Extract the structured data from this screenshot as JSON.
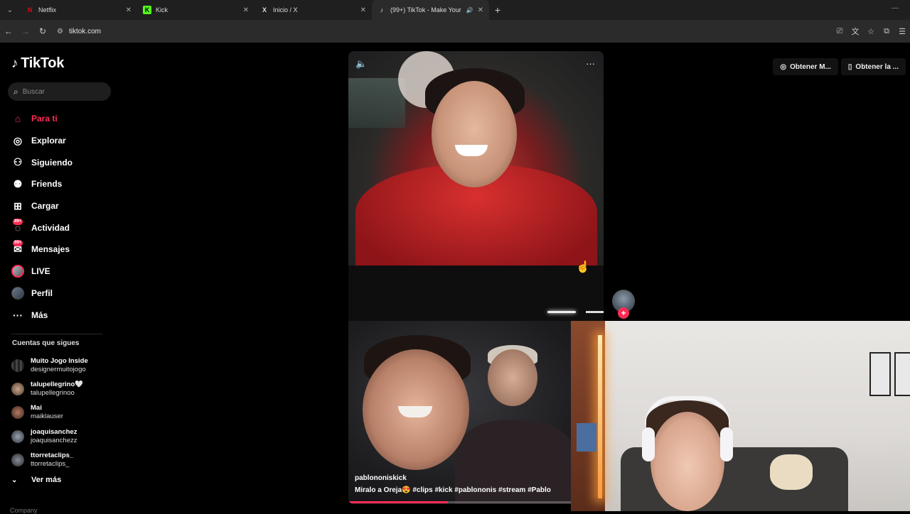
{
  "browser": {
    "tabs": [
      {
        "title": "Netflix",
        "favicon": "N",
        "favicon_color": "#e50914",
        "active": false
      },
      {
        "title": "Kick",
        "favicon": "K",
        "favicon_color": "#53fc18",
        "active": false
      },
      {
        "title": "Inicio / X",
        "favicon": "X",
        "favicon_color": "#ffffff",
        "active": false
      },
      {
        "title": "(99+) TikTok - Make Your Da",
        "favicon": "♪",
        "favicon_color": "#ffffff",
        "active": true
      }
    ],
    "url": "tiktok.com"
  },
  "tiktok": {
    "brand": "TikTok",
    "search_placeholder": "Buscar",
    "nav": [
      {
        "label": "Para ti",
        "icon": "home-icon",
        "active": true
      },
      {
        "label": "Explorar",
        "icon": "compass-icon"
      },
      {
        "label": "Siguiendo",
        "icon": "following-icon"
      },
      {
        "label": "Friends",
        "icon": "friends-icon"
      },
      {
        "label": "Cargar",
        "icon": "upload-icon"
      },
      {
        "label": "Actividad",
        "icon": "activity-icon",
        "badge": "99+"
      },
      {
        "label": "Mensajes",
        "icon": "messages-icon",
        "badge": "99+"
      },
      {
        "label": "LIVE",
        "icon": "live-avatar-icon"
      },
      {
        "label": "Perfil",
        "icon": "profile-avatar-icon"
      },
      {
        "label": "Más",
        "icon": "more-icon"
      }
    ],
    "following_title": "Cuentas que sigues",
    "following": [
      {
        "name": "Muito Jogo Inside",
        "handle": "designermuitojogo"
      },
      {
        "name": "talupellegrino🤍",
        "handle": "talupellegrinoo"
      },
      {
        "name": "Mai",
        "handle": "maiklauser"
      },
      {
        "name": "joaquisanchez",
        "handle": "joaquisanchezz"
      },
      {
        "name": "ttorretaclips_",
        "handle": "ttorretaclips_"
      }
    ],
    "see_more": "Ver más",
    "footer_company": "Company",
    "top_actions": [
      {
        "label": "Obtener M...",
        "icon": "coin-icon"
      },
      {
        "label": "Obtener la ...",
        "icon": "phone-icon"
      }
    ],
    "video": {
      "author": "pablononiskick",
      "description": "Miralo a Oreja😍 #clips #kick #pablononis #stream #Pablo",
      "progress_percent": 39
    }
  },
  "colors": {
    "accent": "#fe2c55",
    "background": "#000000"
  }
}
